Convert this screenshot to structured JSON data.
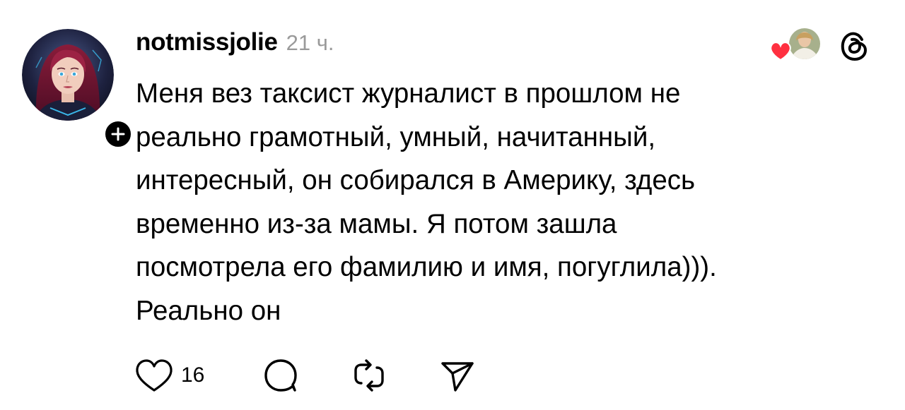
{
  "post": {
    "author": "notmissjolie",
    "time_ago": "21 ч.",
    "text": "Меня вез таксист журналист в прошлом не\nреально грамотный, умный, начитанный,\nинтересный, он собирался в Америку, здесь\nвременно из-за мамы. Я потом зашла\nпосмотрела его фамилию и имя, погуглила))).\nРеально он",
    "like_count": "16"
  },
  "icons": {
    "avatar": "avatar-fantasy-portrait",
    "follow": "plus-icon",
    "liked_by": "heart-with-avatar-icon",
    "logo": "threads-logo-icon",
    "like": "heart-outline-icon",
    "comment": "comment-bubble-icon",
    "repost": "repost-icon",
    "share": "send-icon"
  },
  "colors": {
    "text": "#000000",
    "muted": "#9a9a9a",
    "like_heart": "#ff3040",
    "background": "#ffffff"
  }
}
